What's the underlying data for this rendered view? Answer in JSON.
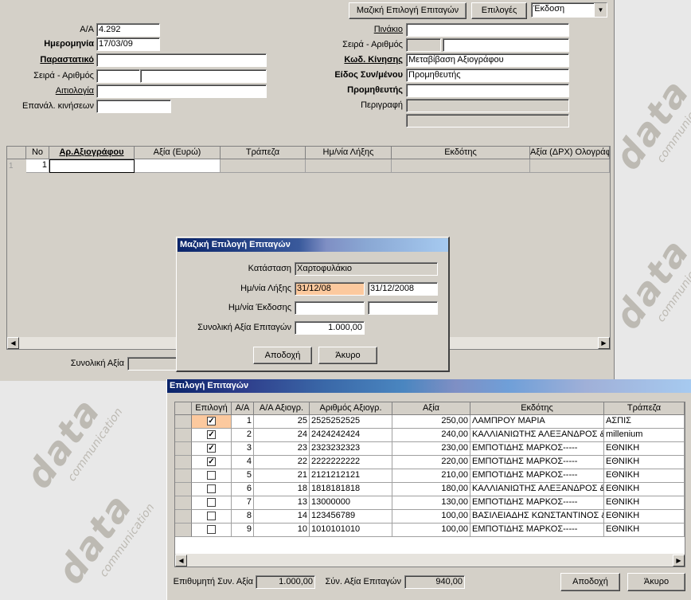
{
  "toolbar": {
    "mass_select_label": "Μαζική Επιλογή Επιταγών",
    "options_label": "Επιλογές",
    "mode_value": "Έκδοση"
  },
  "form": {
    "aa_label": "Α/Α",
    "aa_value": "4.292",
    "date_label": "Ημερομηνία",
    "date_value": "17/03/09",
    "document_label": "Παραστατικό",
    "document_value": "",
    "series_label": "Σειρά - Αριθμός",
    "reason_label": "Αιτιολογία",
    "repeat_label": "Επανάλ. κινήσεων",
    "table_label": "Πινάκιο",
    "series2_label": "Σειρά - Αριθμός",
    "movement_code_label": "Κωδ. Κίνησης",
    "movement_code_value": "Μεταβίβαση Αξιογράφου",
    "counterparty_type_label": "Είδος Συν/μένου",
    "counterparty_type_value": "Προμηθευτής",
    "supplier_label": "Προμηθευτής",
    "supplier_value": "",
    "description_label": "Περιγραφή"
  },
  "top_grid": {
    "headers": [
      "No",
      "Αρ.Αξιογράφου",
      "Αξία (Ευρώ)",
      "Τράπεζα",
      "Ημ/νία Λήξης",
      "Εκδότης",
      "Αξία (ΔΡΧ) Ολογράφω"
    ],
    "row_indicator": "1",
    "row_no": "1"
  },
  "total_label": "Συνολική Αξία",
  "dialog": {
    "title": "Μαζική Επιλογή Επιταγών",
    "status_label": "Κατάσταση",
    "status_value": "Χαρτοφυλάκιο",
    "due_label": "Ημ/νία Λήξης",
    "due_from": "31/12/08",
    "due_to": "31/12/2008",
    "issue_label": "Ημ/νία Έκδοσης",
    "sum_label": "Συνολική Αξία Επιταγών",
    "sum_value": "1.000,00",
    "accept_label": "Αποδοχή",
    "cancel_label": "Άκυρο"
  },
  "selection": {
    "title": "Επιλογή Επιταγών",
    "headers": [
      "Επιλογή",
      "Α/Α",
      "Α/Α Αξιογρ.",
      "Αριθμός Αξιογρ.",
      "Αξία",
      "Εκδότης",
      "Τράπεζα"
    ],
    "rows": [
      {
        "checked": true,
        "aa": "1",
        "aa_check": "25",
        "number": "2525252525",
        "value": "250,00",
        "issuer": "ΛΑΜΠΡΟΥ ΜΑΡΙΑ",
        "bank": "ΑΣΠΙΣ"
      },
      {
        "checked": true,
        "aa": "2",
        "aa_check": "24",
        "number": "2424242424",
        "value": "240,00",
        "issuer": "ΚΑΛΛΙΑΝΙΩΤΗΣ ΑΛΕΞΑΝΔΡΟΣ &",
        "bank": "millenium"
      },
      {
        "checked": true,
        "aa": "3",
        "aa_check": "23",
        "number": "2323232323",
        "value": "230,00",
        "issuer": "ΕΜΠΟΤΙΔΗΣ ΜΑΡΚΟΣ-----",
        "bank": "ΕΘΝΙΚΗ"
      },
      {
        "checked": true,
        "aa": "4",
        "aa_check": "22",
        "number": "2222222222",
        "value": "220,00",
        "issuer": "ΕΜΠΟΤΙΔΗΣ ΜΑΡΚΟΣ-----",
        "bank": "ΕΘΝΙΚΗ"
      },
      {
        "checked": false,
        "aa": "5",
        "aa_check": "21",
        "number": "2121212121",
        "value": "210,00",
        "issuer": "ΕΜΠΟΤΙΔΗΣ ΜΑΡΚΟΣ-----",
        "bank": "ΕΘΝΙΚΗ"
      },
      {
        "checked": false,
        "aa": "6",
        "aa_check": "18",
        "number": "1818181818",
        "value": "180,00",
        "issuer": "ΚΑΛΛΙΑΝΙΩΤΗΣ ΑΛΕΞΑΝΔΡΟΣ &",
        "bank": "ΕΘΝΙΚΗ"
      },
      {
        "checked": false,
        "aa": "7",
        "aa_check": "13",
        "number": "13000000",
        "value": "130,00",
        "issuer": "ΕΜΠΟΤΙΔΗΣ ΜΑΡΚΟΣ-----",
        "bank": "ΕΘΝΙΚΗ"
      },
      {
        "checked": false,
        "aa": "8",
        "aa_check": "14",
        "number": "123456789",
        "value": "100,00",
        "issuer": "ΒΑΣΙΛΕΙΑΔΗΣ ΚΩΝΣΤΑΝΤΙΝΟΣ &",
        "bank": "ΕΘΝΙΚΗ"
      },
      {
        "checked": false,
        "aa": "9",
        "aa_check": "10",
        "number": "1010101010",
        "value": "100,00",
        "issuer": "ΕΜΠΟΤΙΔΗΣ ΜΑΡΚΟΣ-----",
        "bank": "ΕΘΝΙΚΗ"
      }
    ],
    "target_label": "Επιθυμητή Συν. Αξία",
    "target_value": "1.000,00",
    "total_label": "Σύν. Αξία Επιταγών",
    "total_value": "940,00",
    "accept_label": "Αποδοχή",
    "cancel_label": "Άκυρο"
  },
  "watermark": {
    "brand": "data",
    "sub": "communication"
  },
  "colors": {
    "title_dark": "#0a246a",
    "title_light": "#a6caf0",
    "peach": "#fcc99e"
  }
}
